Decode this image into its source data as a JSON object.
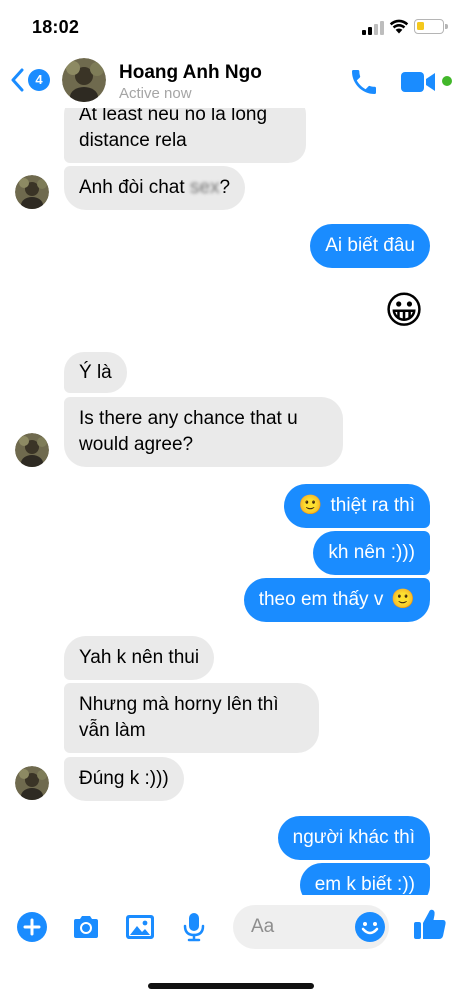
{
  "status_bar": {
    "time": "18:02",
    "battery_level": 0.3
  },
  "header": {
    "back_count": "4",
    "contact_name": "Hoang Anh Ngo",
    "contact_status": "Active now"
  },
  "messages": [
    {
      "sender": "contact",
      "text": "At least neu no la long distance rela"
    },
    {
      "sender": "contact",
      "text_before": "Anh đòi chat ",
      "censored": "sex",
      "text_after": "?"
    },
    {
      "sender": "me",
      "text": "Ai biết đâu"
    },
    {
      "sender": "me",
      "emoji": "😀"
    },
    {
      "sender": "contact",
      "text": "Ý là"
    },
    {
      "sender": "contact",
      "text": "Is there any chance that u would agree?"
    },
    {
      "sender": "me",
      "emoji_before": "🙂",
      "text": "thiệt ra thì"
    },
    {
      "sender": "me",
      "text": "kh nên :)))"
    },
    {
      "sender": "me",
      "text": "theo em thấy v",
      "emoji_after": "🙂"
    },
    {
      "sender": "contact",
      "text": "Yah k nên thui"
    },
    {
      "sender": "contact",
      "text": "Nhưng mà horny lên thì vẫn làm"
    },
    {
      "sender": "contact",
      "text": "Đúng k :)))"
    },
    {
      "sender": "me",
      "text": "người khác thì"
    },
    {
      "sender": "me",
      "text": "em k biết :))"
    }
  ],
  "composer": {
    "placeholder": "Aa"
  },
  "colors": {
    "accent": "#1a8cff",
    "incoming_bubble": "#eaeaea",
    "active_green": "#42b72a",
    "battery_yellow": "#f4c81c"
  },
  "icons": [
    "back-chevron-icon",
    "phone-icon",
    "video-camera-icon",
    "plus-icon",
    "camera-icon",
    "image-icon",
    "microphone-icon",
    "smiley-icon",
    "thumbs-up-icon"
  ]
}
